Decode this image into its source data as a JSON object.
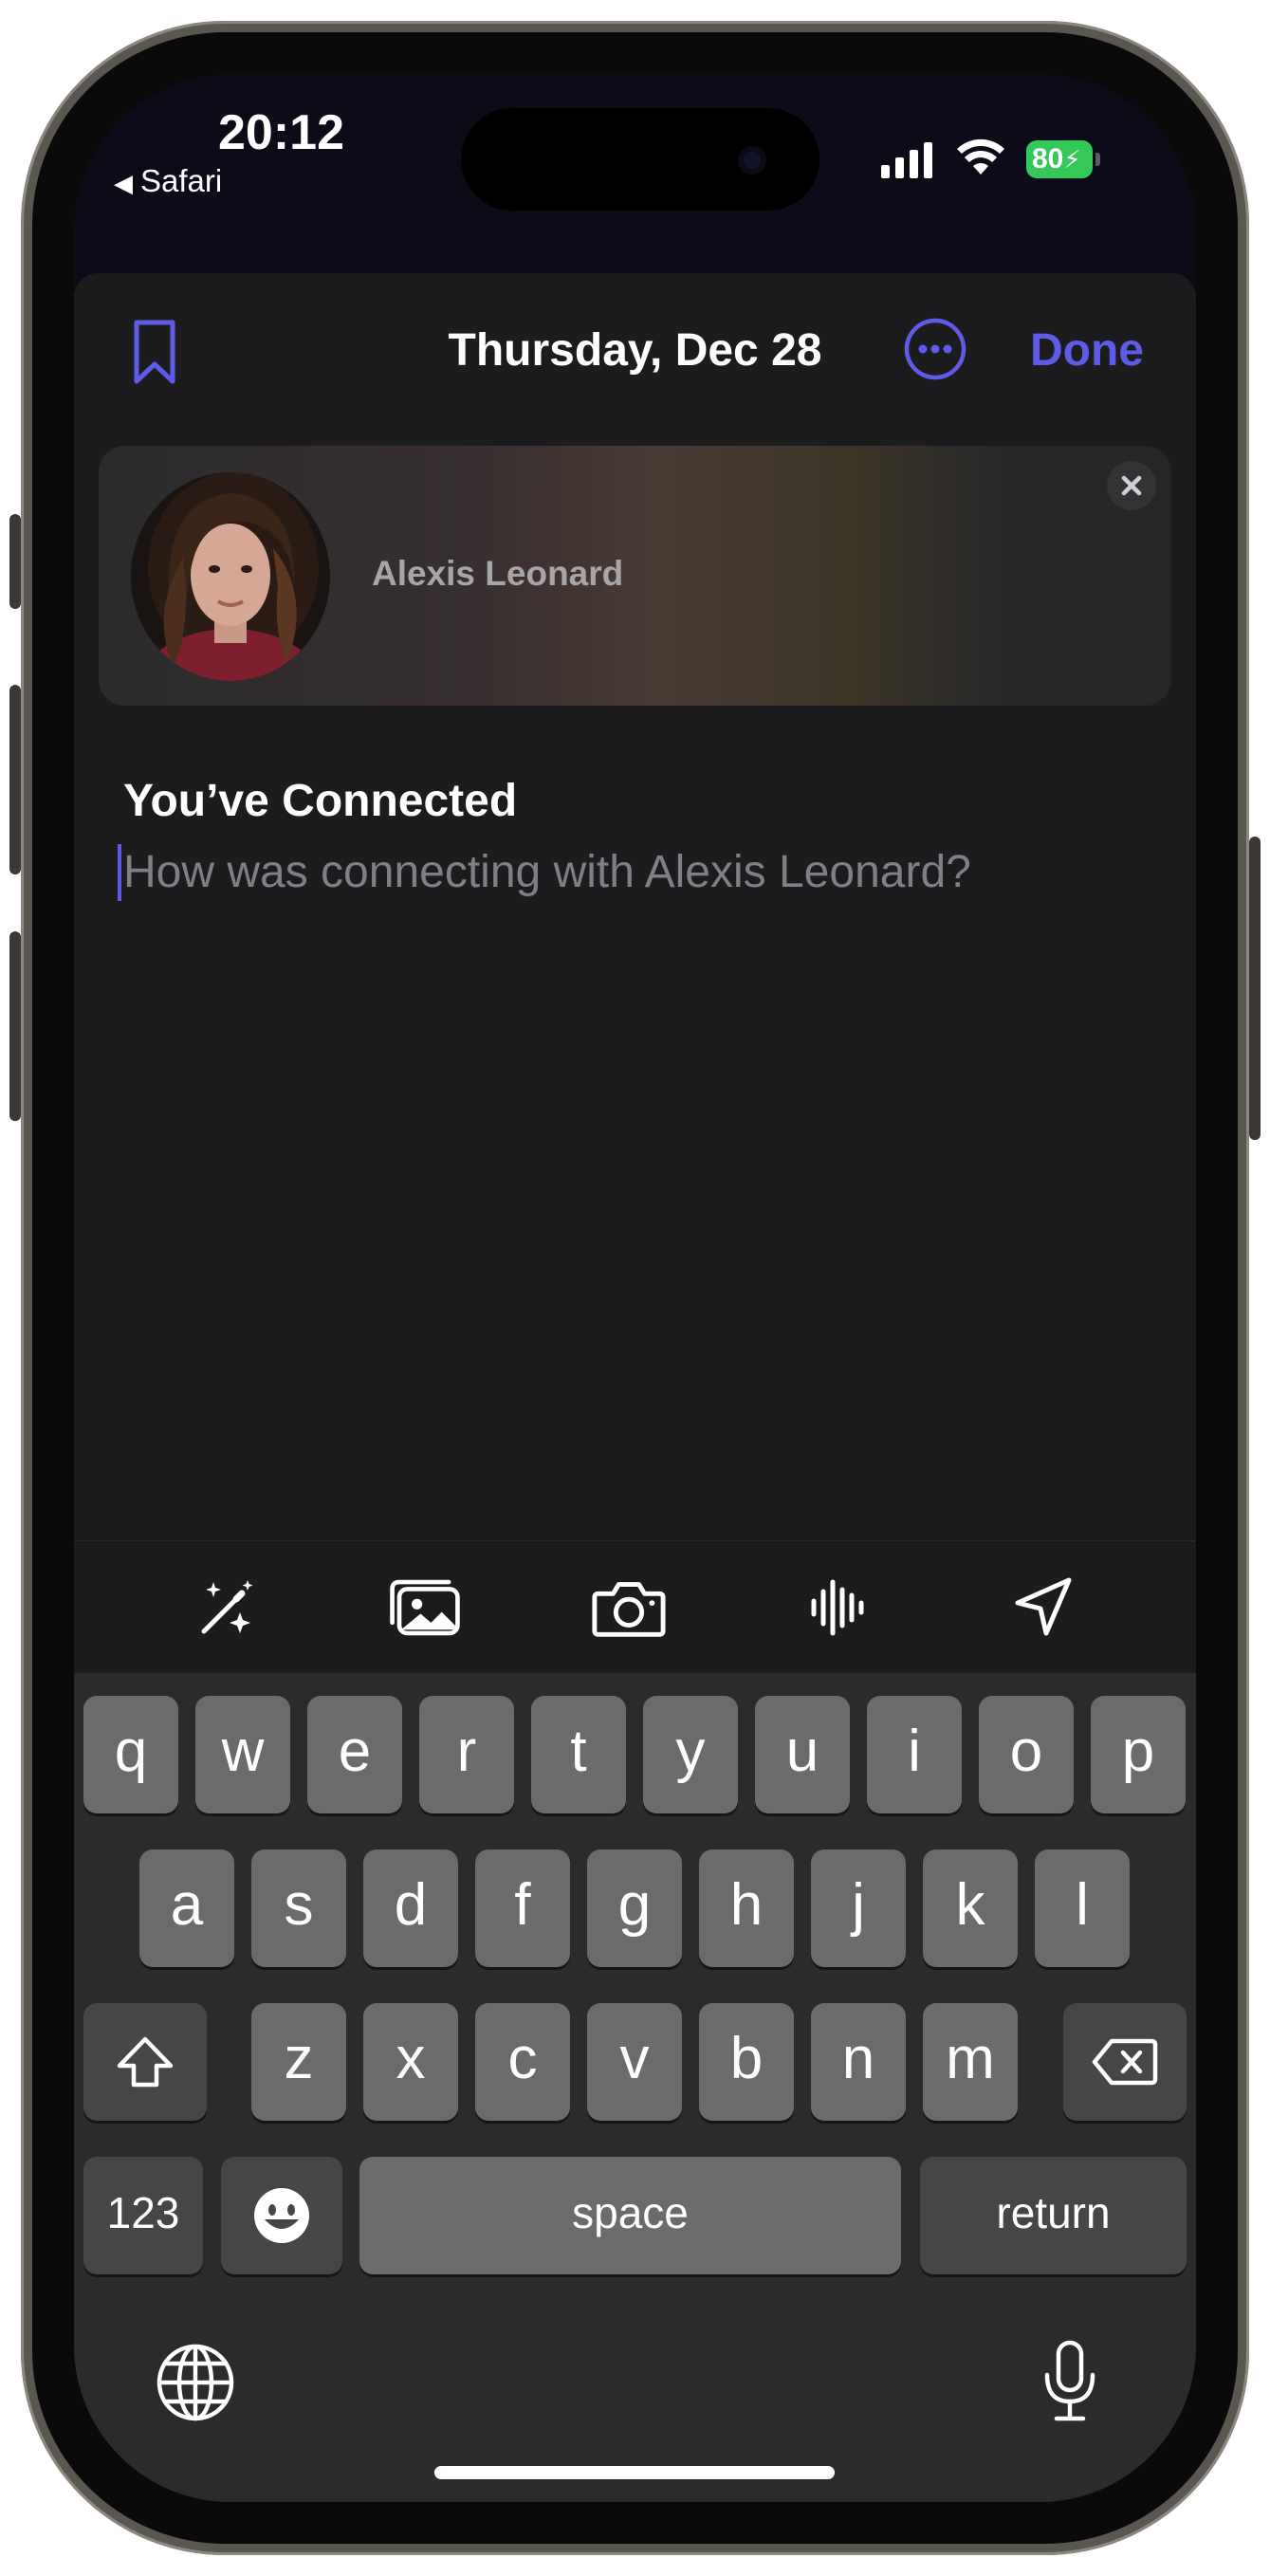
{
  "status_bar": {
    "time": "20:12",
    "back_app": "Safari",
    "battery": "80"
  },
  "nav": {
    "date": "Thursday, Dec 28",
    "done": "Done",
    "accent_color": "#5e5ce6"
  },
  "contact_card": {
    "name": "Alexis Leonard",
    "close_icon": "close-icon"
  },
  "entry": {
    "title": "You’ve Connected",
    "placeholder": "How was connecting with Alexis Leonard?"
  },
  "toolbar": {
    "icons": [
      "magic-wand-icon",
      "photo-library-icon",
      "camera-icon",
      "audio-waveform-icon",
      "location-arrow-icon"
    ]
  },
  "keyboard": {
    "row1": [
      "q",
      "w",
      "e",
      "r",
      "t",
      "y",
      "u",
      "i",
      "o",
      "p"
    ],
    "row2": [
      "a",
      "s",
      "d",
      "f",
      "g",
      "h",
      "j",
      "k",
      "l"
    ],
    "row3": [
      "z",
      "x",
      "c",
      "v",
      "b",
      "n",
      "m"
    ],
    "numbers_key": "123",
    "space_key": "space",
    "return_key": "return"
  }
}
